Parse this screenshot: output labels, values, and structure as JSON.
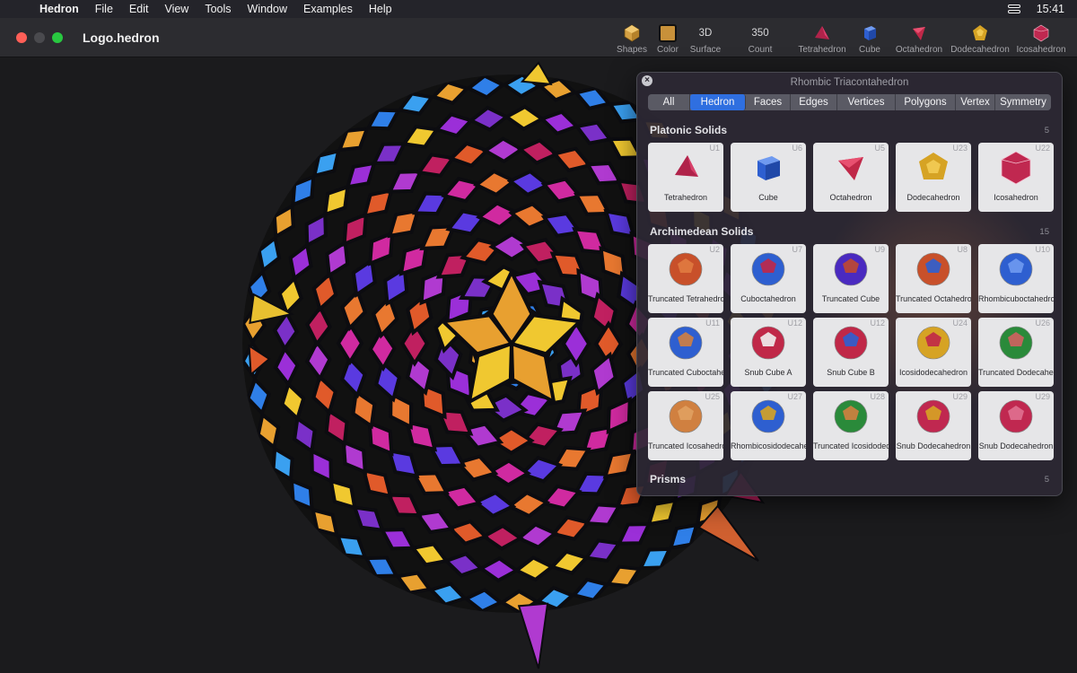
{
  "menubar": {
    "app_name": "Hedron",
    "items": [
      "File",
      "Edit",
      "View",
      "Tools",
      "Window",
      "Examples",
      "Help"
    ],
    "time": "15:41"
  },
  "window": {
    "title": "Logo.hedron",
    "tools": {
      "shapes": "Shapes",
      "color": "Color",
      "surface_value": "3D",
      "surface": "Surface",
      "count_value": "350",
      "count": "Count",
      "tetrahedron": "Tetrahedron",
      "cube": "Cube",
      "octahedron": "Octahedron",
      "dodecahedron": "Dodecahedron",
      "icosahedron": "Icosahedron"
    }
  },
  "panel": {
    "title": "Rhombic Triacontahedron",
    "tabs": [
      "All",
      "Hedron",
      "Faces",
      "Edges",
      "Vertices",
      "Polygons",
      "Vertex",
      "Symmetry"
    ],
    "active_tab": "Hedron",
    "sections": [
      {
        "title": "Platonic Solids",
        "count": "5",
        "items": [
          {
            "name": "Tetrahedron",
            "code": "U1"
          },
          {
            "name": "Cube",
            "code": "U6"
          },
          {
            "name": "Octahedron",
            "code": "U5"
          },
          {
            "name": "Dodecahedron",
            "code": "U23"
          },
          {
            "name": "Icosahedron",
            "code": "U22"
          }
        ]
      },
      {
        "title": "Archimedean Solids",
        "count": "15",
        "items": [
          {
            "name": "Truncated Tetrahedron",
            "code": "U2"
          },
          {
            "name": "Cuboctahedron",
            "code": "U7"
          },
          {
            "name": "Truncated Cube",
            "code": "U9"
          },
          {
            "name": "Truncated Octahedron",
            "code": "U8"
          },
          {
            "name": "Rhombicuboctahedron",
            "code": "U10"
          },
          {
            "name": "Truncated Cuboctahedron",
            "code": "U11"
          },
          {
            "name": "Snub Cube A",
            "code": "U12"
          },
          {
            "name": "Snub Cube B",
            "code": "U12"
          },
          {
            "name": "Icosidodecahedron",
            "code": "U24"
          },
          {
            "name": "Truncated Dodecahedron",
            "code": "U26"
          },
          {
            "name": "Truncated Icosahedron",
            "code": "U25"
          },
          {
            "name": "Rhombicosidodecahedron",
            "code": "U27"
          },
          {
            "name": "Truncated Icosidodecahedron",
            "code": "U28"
          },
          {
            "name": "Snub Dodecahedron",
            "code": "U29"
          },
          {
            "name": "Snub Dodecahedron",
            "code": "U29"
          }
        ]
      },
      {
        "title": "Prisms",
        "count": "5"
      }
    ]
  },
  "colors": {
    "accent": "#2f6fe0",
    "swatch": "#c8913a",
    "red": "#ff5f57",
    "tetra": "#b0234a",
    "cube": "#2e5fd0",
    "octa": "#c02848",
    "dodeca": "#d6a324",
    "icosa": "#c02850"
  }
}
